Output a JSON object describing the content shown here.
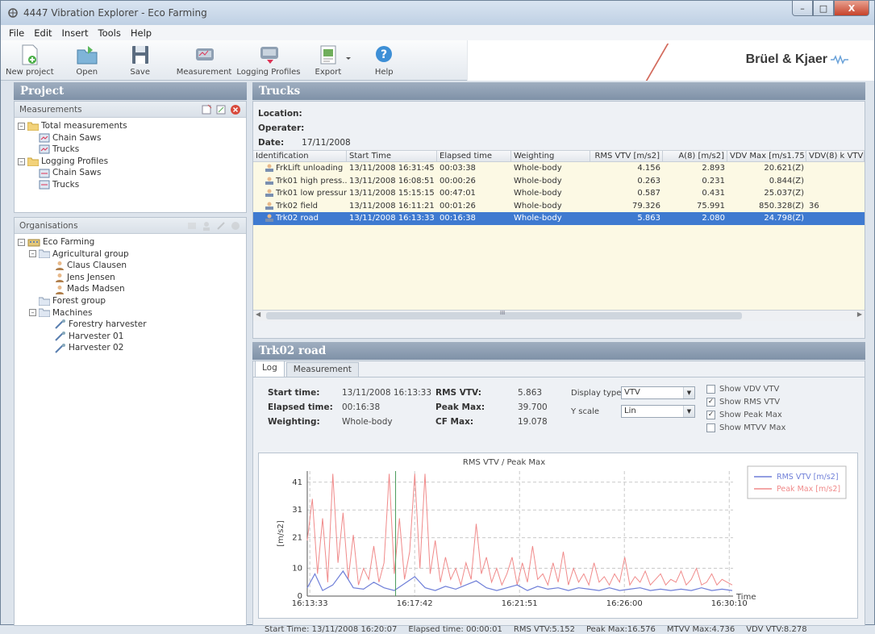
{
  "window": {
    "title": "4447 Vibration Explorer - Eco Farming"
  },
  "menu": [
    "File",
    "Edit",
    "Insert",
    "Tools",
    "Help"
  ],
  "toolbar": {
    "buttons": [
      {
        "label": "New project",
        "icon": "new-project-icon"
      },
      {
        "label": "Open",
        "icon": "open-folder-icon"
      },
      {
        "label": "Save",
        "icon": "save-icon"
      },
      {
        "label": "Measurement",
        "icon": "measurement-icon"
      },
      {
        "label": "Logging Profiles",
        "icon": "logging-profiles-icon"
      },
      {
        "label": "Export",
        "icon": "export-icon"
      },
      {
        "label": "Help",
        "icon": "help-icon"
      }
    ]
  },
  "brand": {
    "name": "Brüel & Kjaer",
    "accent": "#d36b5d"
  },
  "project": {
    "title": "Project",
    "measurements_title": "Measurements",
    "measurements_tree": {
      "total": "Total measurements",
      "total_children": [
        "Chain Saws",
        "Trucks"
      ],
      "logging": "Logging Profiles",
      "logging_children": [
        "Chain Saws",
        "Trucks"
      ]
    },
    "organisations_title": "Organisations",
    "org_tree": {
      "root": "Eco Farming",
      "agri": "Agricultural group",
      "agri_people": [
        "Claus Clausen",
        "Jens Jensen",
        "Mads Madsen"
      ],
      "forest": "Forest group",
      "machines": "Machines",
      "machine_items": [
        "Forestry harvester",
        "Harvester 01",
        "Harvester 02"
      ]
    }
  },
  "trucks": {
    "title": "Trucks",
    "location_label": "Location:",
    "operator_label": "Operater:",
    "date_label": "Date:",
    "date_value": "17/11/2008",
    "columns": [
      "Identification",
      "Start Time",
      "Elapsed time",
      "Weighting",
      "RMS VTV [m/s2]",
      "A(8) [m/s2]",
      "VDV Max [m/s1.75]",
      "VDV(8) k VTV [m"
    ],
    "rows": [
      [
        "FrkLift unloading",
        "13/11/2008 16:31:45",
        "00:03:38",
        "Whole-body",
        "4.156",
        "2.893",
        "20.621(Z)",
        ""
      ],
      [
        "Trk01 high press...",
        "13/11/2008 16:08:51",
        "00:00:26",
        "Whole-body",
        "0.263",
        "0.231",
        "0.844(Z)",
        ""
      ],
      [
        "Trk01 low pressure",
        "13/11/2008 15:15:15",
        "00:47:01",
        "Whole-body",
        "0.587",
        "0.431",
        "25.037(Z)",
        ""
      ],
      [
        "Trk02 field",
        "13/11/2008 16:11:21",
        "00:01:26",
        "Whole-body",
        "79.326",
        "75.991",
        "850.328(Z)",
        "36"
      ],
      [
        "Trk02 road",
        "13/11/2008 16:13:33",
        "00:16:38",
        "Whole-body",
        "5.863",
        "2.080",
        "24.798(Z)",
        ""
      ]
    ],
    "selected_row": 4,
    "scroll_mark": "III"
  },
  "detail": {
    "title": "Trk02 road",
    "tabs": [
      "Log",
      "Measurement"
    ],
    "start_time_label": "Start time:",
    "start_time_value": "13/11/2008 16:13:33",
    "elapsed_label": "Elapsed time:",
    "elapsed_value": "00:16:38",
    "weighting_label": "Weighting:",
    "weighting_value": "Whole-body",
    "rms_label": "RMS VTV:",
    "rms_value": "5.863",
    "peak_label": "Peak Max:",
    "peak_value": "39.700",
    "crest_label": "CF Max:",
    "crest_value": "19.078",
    "display_type_label": "Display type",
    "display_type_value": "VTV",
    "yscale_label": "Y scale",
    "yscale_value": "Lin",
    "checks": [
      {
        "label": "Show VDV VTV",
        "checked": false
      },
      {
        "label": "Show RMS VTV",
        "checked": true
      },
      {
        "label": "Show Peak Max",
        "checked": true
      },
      {
        "label": "Show MTVV Max",
        "checked": false
      }
    ],
    "status": {
      "start": "Start Time: 13/11/2008 16:20:07",
      "elapsed": "Elapsed time: 00:00:01",
      "rms": "RMS VTV:5.152",
      "peak": "Peak Max:16.576",
      "mtvv": "MTVV Max:4.736",
      "vdv": "VDV VTV:8.278"
    }
  },
  "chart_data": {
    "type": "line",
    "title": "RMS VTV / Peak Max",
    "xlabel": "Time",
    "ylabel": "[m/s2]",
    "y_ticks": [
      0,
      10,
      21,
      31,
      41
    ],
    "ylim": [
      0,
      45
    ],
    "x_ticks": [
      "16:13:33",
      "16:17:42",
      "16:21:51",
      "16:26:00",
      "16:30:10"
    ],
    "xlim_minutes": [
      0,
      16.63
    ],
    "grid": true,
    "legend": "top-right",
    "series": [
      {
        "name": "RMS VTV [m/s2]",
        "color": "#6f7fd8",
        "points": [
          [
            0,
            3
          ],
          [
            0.3,
            8
          ],
          [
            0.6,
            2
          ],
          [
            1,
            4
          ],
          [
            1.4,
            9
          ],
          [
            1.8,
            3
          ],
          [
            2.2,
            2.5
          ],
          [
            2.6,
            5
          ],
          [
            3,
            3
          ],
          [
            3.4,
            2
          ],
          [
            3.8,
            4.5
          ],
          [
            4.2,
            7
          ],
          [
            4.6,
            3
          ],
          [
            5,
            2
          ],
          [
            5.4,
            3.5
          ],
          [
            5.8,
            2.5
          ],
          [
            6.2,
            4
          ],
          [
            6.6,
            5.5
          ],
          [
            7,
            3
          ],
          [
            7.4,
            2
          ],
          [
            7.8,
            3
          ],
          [
            8.2,
            4
          ],
          [
            8.6,
            2
          ],
          [
            9,
            3.5
          ],
          [
            9.4,
            2.5
          ],
          [
            9.8,
            3
          ],
          [
            10.2,
            2
          ],
          [
            10.6,
            3
          ],
          [
            11,
            2.5
          ],
          [
            11.4,
            2
          ],
          [
            11.8,
            3
          ],
          [
            12.2,
            2
          ],
          [
            12.6,
            2.5
          ],
          [
            13,
            3
          ],
          [
            13.4,
            2
          ],
          [
            13.8,
            2.5
          ],
          [
            14.2,
            2
          ],
          [
            14.6,
            2.5
          ],
          [
            15,
            2
          ],
          [
            15.4,
            3
          ],
          [
            15.8,
            2
          ],
          [
            16.2,
            2.5
          ],
          [
            16.6,
            2
          ]
        ]
      },
      {
        "name": "Peak Max [m/s2]",
        "color": "#f08a8a",
        "points": [
          [
            0,
            20
          ],
          [
            0.2,
            35
          ],
          [
            0.4,
            8
          ],
          [
            0.6,
            28
          ],
          [
            0.8,
            5
          ],
          [
            1.0,
            44
          ],
          [
            1.2,
            12
          ],
          [
            1.4,
            30
          ],
          [
            1.6,
            6
          ],
          [
            1.8,
            22
          ],
          [
            2.0,
            4
          ],
          [
            2.2,
            10
          ],
          [
            2.4,
            6
          ],
          [
            2.6,
            18
          ],
          [
            2.8,
            5
          ],
          [
            3.0,
            12
          ],
          [
            3.2,
            44
          ],
          [
            3.4,
            8
          ],
          [
            3.6,
            28
          ],
          [
            3.8,
            6
          ],
          [
            4.0,
            16
          ],
          [
            4.2,
            44
          ],
          [
            4.4,
            10
          ],
          [
            4.6,
            44
          ],
          [
            4.8,
            8
          ],
          [
            5.0,
            20
          ],
          [
            5.2,
            5
          ],
          [
            5.4,
            14
          ],
          [
            5.6,
            6
          ],
          [
            5.8,
            10
          ],
          [
            6.0,
            4
          ],
          [
            6.2,
            12
          ],
          [
            6.4,
            6
          ],
          [
            6.6,
            26
          ],
          [
            6.8,
            8
          ],
          [
            7.0,
            14
          ],
          [
            7.2,
            5
          ],
          [
            7.4,
            10
          ],
          [
            7.6,
            4
          ],
          [
            7.8,
            8
          ],
          [
            8.0,
            14
          ],
          [
            8.2,
            4
          ],
          [
            8.4,
            12
          ],
          [
            8.6,
            5
          ],
          [
            8.8,
            18
          ],
          [
            9.0,
            6
          ],
          [
            9.2,
            8
          ],
          [
            9.4,
            4
          ],
          [
            9.6,
            12
          ],
          [
            9.8,
            5
          ],
          [
            10.0,
            16
          ],
          [
            10.2,
            4
          ],
          [
            10.4,
            10
          ],
          [
            10.6,
            5
          ],
          [
            10.8,
            8
          ],
          [
            11.0,
            4
          ],
          [
            11.2,
            12
          ],
          [
            11.4,
            5
          ],
          [
            11.6,
            7
          ],
          [
            11.8,
            4
          ],
          [
            12.0,
            8
          ],
          [
            12.2,
            5
          ],
          [
            12.4,
            14
          ],
          [
            12.6,
            4
          ],
          [
            12.8,
            7
          ],
          [
            13.0,
            5
          ],
          [
            13.2,
            9
          ],
          [
            13.4,
            4
          ],
          [
            13.6,
            6
          ],
          [
            13.8,
            8
          ],
          [
            14.0,
            4
          ],
          [
            14.2,
            6
          ],
          [
            14.4,
            5
          ],
          [
            14.6,
            9
          ],
          [
            14.8,
            4
          ],
          [
            15.0,
            6
          ],
          [
            15.2,
            10
          ],
          [
            15.4,
            4
          ],
          [
            15.6,
            5
          ],
          [
            15.8,
            8
          ],
          [
            16.0,
            4
          ],
          [
            16.2,
            6
          ],
          [
            16.4,
            5
          ],
          [
            16.6,
            4
          ]
        ]
      }
    ],
    "cursor_x": 3.45
  }
}
